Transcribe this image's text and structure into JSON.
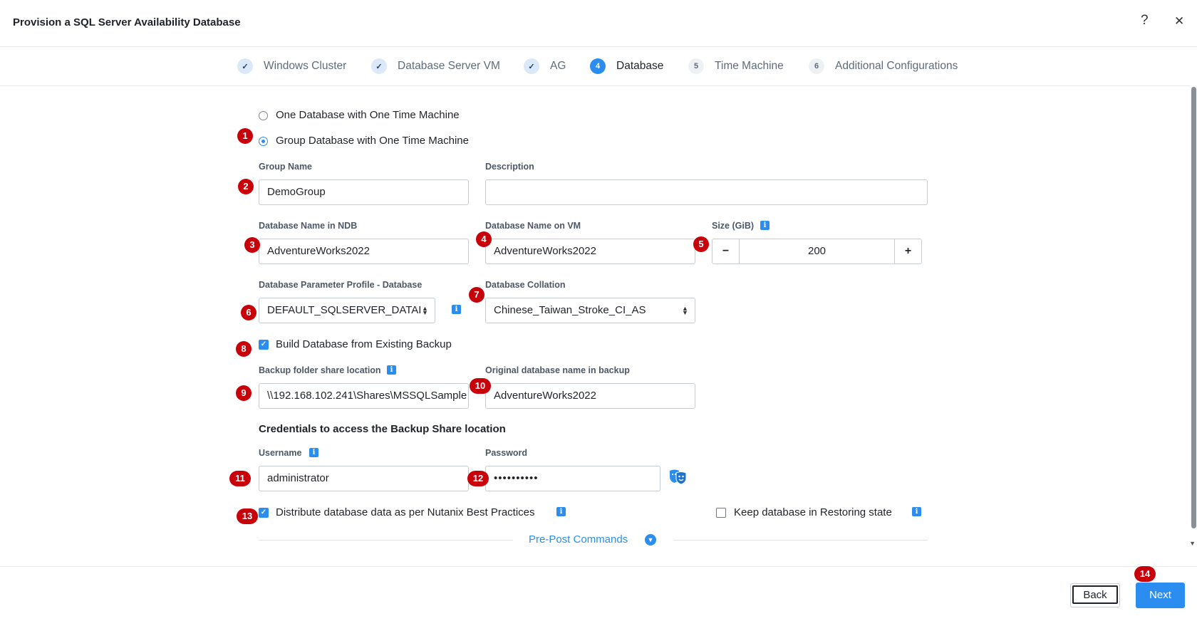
{
  "dialog": {
    "title": "Provision a SQL Server Availability Database",
    "help": "?",
    "close": "✕"
  },
  "steps": [
    {
      "num": "✓",
      "label": "Windows Cluster",
      "state": "done"
    },
    {
      "num": "✓",
      "label": "Database Server VM",
      "state": "done"
    },
    {
      "num": "✓",
      "label": "AG",
      "state": "done"
    },
    {
      "num": "4",
      "label": "Database",
      "state": "active"
    },
    {
      "num": "5",
      "label": "Time Machine",
      "state": "todo"
    },
    {
      "num": "6",
      "label": "Additional Configurations",
      "state": "todo"
    }
  ],
  "mode": {
    "option_one": "One Database with One Time Machine",
    "option_group": "Group Database with One Time Machine",
    "selected": "group"
  },
  "fields": {
    "group_name_label": "Group Name",
    "group_name_value": "DemoGroup",
    "description_label": "Description",
    "description_value": "",
    "db_name_ndb_label": "Database Name in NDB",
    "db_name_ndb_value": "AdventureWorks2022",
    "db_name_vm_label": "Database Name on VM",
    "db_name_vm_value": "AdventureWorks2022",
    "size_label": "Size (GiB)",
    "size_value": "200",
    "size_minus": "−",
    "size_plus": "+",
    "param_profile_label": "Database Parameter Profile - Database",
    "param_profile_value": "DEFAULT_SQLSERVER_DATAI",
    "collation_label": "Database Collation",
    "collation_value": "Chinese_Taiwan_Stroke_CI_AS",
    "build_from_backup_label": "Build Database from Existing Backup",
    "backup_share_label": "Backup folder share location",
    "backup_share_value": "\\\\192.168.102.241\\Shares\\MSSQLSample",
    "original_db_label": "Original database name in backup",
    "original_db_value": "AdventureWorks2022",
    "credentials_heading": "Credentials to access the Backup Share location",
    "username_label": "Username",
    "username_value": "administrator",
    "password_label": "Password",
    "password_value": "••••••••••",
    "distribute_label": "Distribute database data as per Nutanix Best Practices",
    "restoring_label": "Keep database in Restoring state",
    "prepost_label": "Pre-Post Commands"
  },
  "info_icon": "i",
  "badges": [
    "1",
    "2",
    "3",
    "4",
    "5",
    "6",
    "7",
    "8",
    "9",
    "10",
    "11",
    "12",
    "13",
    "14"
  ],
  "footer": {
    "back": "Back",
    "next": "Next"
  },
  "colors": {
    "accent": "#2c8df0",
    "badge": "#c8000a"
  }
}
